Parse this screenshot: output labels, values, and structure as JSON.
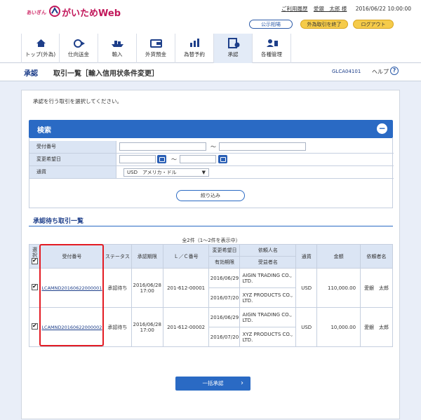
{
  "brand": {
    "small": "あいぎん",
    "name": "がいためWeb"
  },
  "toplinks": {
    "history": "ご利用履歴",
    "user": "愛銀　太郎 様",
    "datetime": "2016/06/22 10:00:00"
  },
  "buttons": {
    "rates": "公示相場",
    "fx_end": "外為取引を終了",
    "logout": "ログアウト"
  },
  "nav": [
    {
      "label": "トップ(外為)",
      "icon": "home-icon"
    },
    {
      "label": "仕向送金",
      "icon": "remittance-icon"
    },
    {
      "label": "輸入",
      "icon": "ship-icon"
    },
    {
      "label": "外貨預金",
      "icon": "deposit-icon"
    },
    {
      "label": "為替予約",
      "icon": "chart-icon"
    },
    {
      "label": "承認",
      "icon": "approval-icon"
    },
    {
      "label": "各種管理",
      "icon": "admin-icon"
    }
  ],
  "titlebar": {
    "section": "承認",
    "title": "取引一覧［輸入信用状条件変更］",
    "code": "GLCA04101",
    "help": "ヘルプ",
    "help_icon": "?"
  },
  "intro": "承認を行う取引を選択してください。",
  "search": {
    "title": "検索",
    "toggle": "−",
    "rows": {
      "ref": "受付番号",
      "date": "変更希望日",
      "currency": "通貨"
    },
    "tilde": "～",
    "currency_value": "USD　アメリカ・ドル",
    "select_arrow": "▼",
    "filter_button": "絞り込み"
  },
  "list": {
    "title": "承認待ち取引一覧",
    "count": "全2件（1～2件を表示中）",
    "headers": {
      "select": "選択",
      "ref": "受付番号",
      "status": "ステータス",
      "deadline": "承認期限",
      "lc": "Ｌ／Ｃ番号",
      "change_date": "変更希望日",
      "expiry": "有効期限",
      "applicant": "依頼人名",
      "beneficiary": "受益者名",
      "currency": "通貨",
      "amount": "金額",
      "requester": "依頼者名"
    },
    "rows": [
      {
        "ref": "LCAMND20160622000001",
        "status": "承認待ち",
        "deadline": "2016/06/28\n17:00",
        "lc": "201-612-00001",
        "change_date": "2016/06/29",
        "expiry": "2016/07/20",
        "applicant": "AIGIN TRADING CO., LTD.",
        "beneficiary": "XYZ PRODUCTS CO., LTD.",
        "currency": "USD",
        "amount": "110,000.00",
        "requester": "愛銀　太郎"
      },
      {
        "ref": "LCAMND20160622000002",
        "status": "承認待ち",
        "deadline": "2016/06/28\n17:00",
        "lc": "201-612-00002",
        "change_date": "2016/06/29",
        "expiry": "2016/07/20",
        "applicant": "AIGIN TRADING CO., LTD.",
        "beneficiary": "XYZ PRODUCTS CO., LTD.",
        "currency": "USD",
        "amount": "10,000.00",
        "requester": "愛銀　太郎"
      }
    ]
  },
  "submit": {
    "label": "一括承認",
    "chevron": "›"
  },
  "colors": {
    "primary": "#2a6ac4",
    "highlight": "#e31b23",
    "accent": "#c2185b"
  }
}
